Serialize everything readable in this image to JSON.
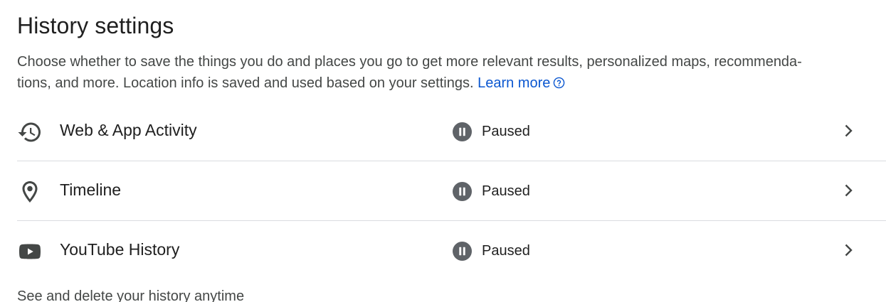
{
  "title": "History settings",
  "description": {
    "line1": "Choose whether to save the things you do and places you go to get more relevant results, personalized maps, recommenda-",
    "line2": "tions, and more. Location info is saved and used based on your settings.",
    "learn_more": "Learn more",
    "help_icon": "help-circle-icon"
  },
  "settings": [
    {
      "label": "Web & App Activity",
      "icon": "history-icon",
      "status": "Paused",
      "status_icon": "pause-circle-icon"
    },
    {
      "label": "Timeline",
      "icon": "location-pin-icon",
      "status": "Paused",
      "status_icon": "pause-circle-icon"
    },
    {
      "label": "YouTube History",
      "icon": "youtube-icon",
      "status": "Paused",
      "status_icon": "pause-circle-icon"
    }
  ],
  "footer": "See and delete your history anytime",
  "colors": {
    "link": "#0b57d0",
    "text": "#1f1f1f",
    "secondary_text": "#444746",
    "icon": "#444746",
    "divider": "#dadce0"
  }
}
